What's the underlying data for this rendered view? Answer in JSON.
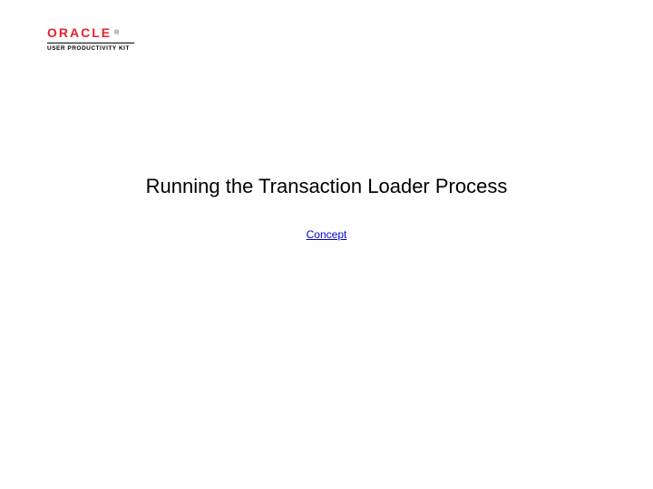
{
  "logo": {
    "brand": "ORACLE",
    "subtitle": "USER PRODUCTIVITY KIT"
  },
  "page": {
    "title": "Running the Transaction Loader Process",
    "link_label": "Concept"
  }
}
